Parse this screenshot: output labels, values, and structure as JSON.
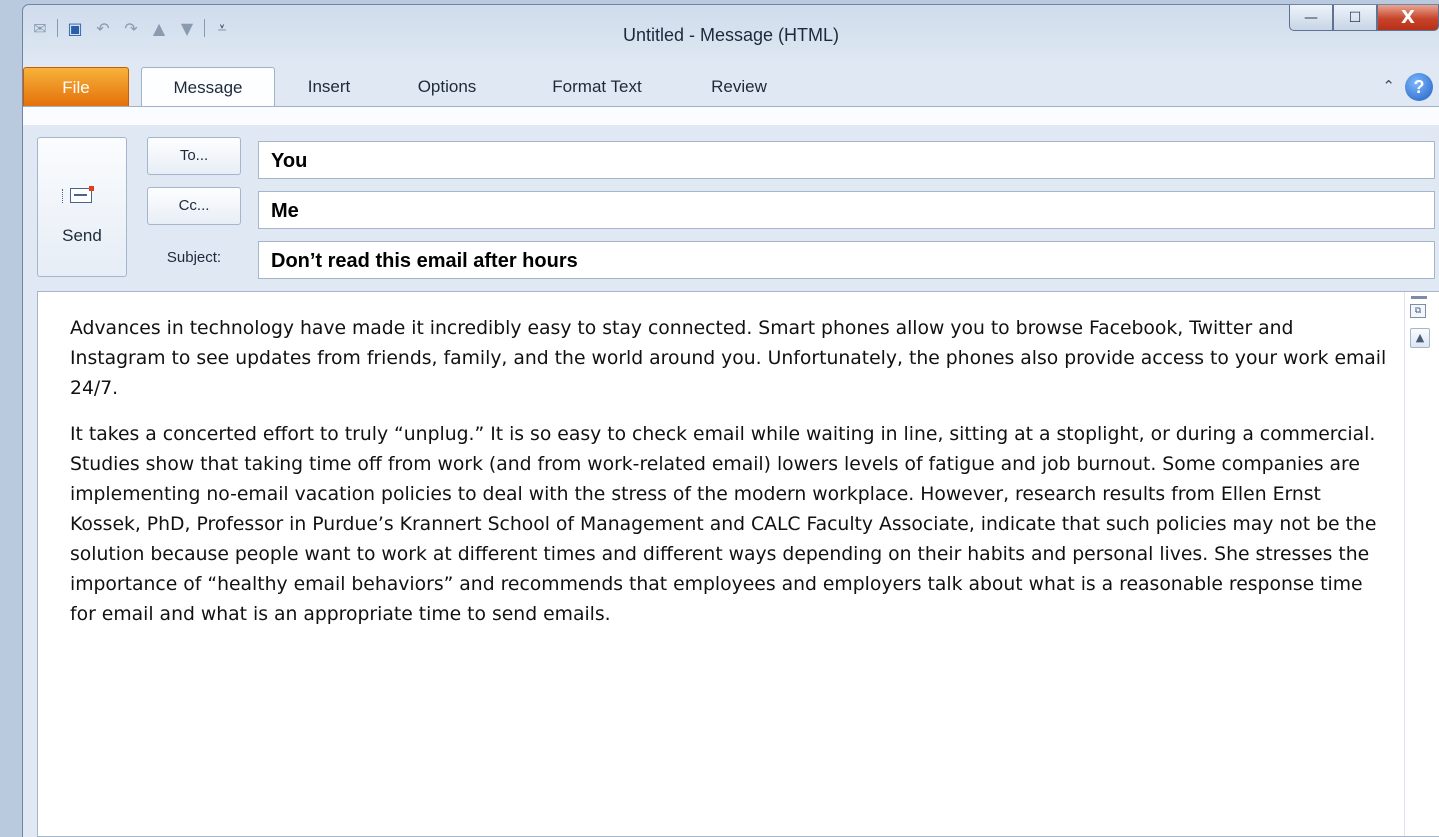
{
  "window": {
    "title": "Untitled - Message (HTML)",
    "controls": {
      "minimize": "—",
      "maximize": "☐",
      "close": "X"
    }
  },
  "quick_access": {
    "icons": [
      "mail-app-icon",
      "save-icon",
      "undo-icon",
      "redo-icon",
      "previous-item-icon",
      "next-item-icon",
      "customize-toolbar-icon"
    ]
  },
  "ribbon": {
    "tabs": [
      "File",
      "Message",
      "Insert",
      "Options",
      "Format Text",
      "Review"
    ],
    "active_tab": "Message",
    "help_label": "?"
  },
  "header": {
    "send_label": "Send",
    "to_button": "To...",
    "cc_button": "Cc...",
    "subject_label": "Subject:",
    "to_value": "You",
    "cc_value": "Me",
    "subject_value": "Don’t read this email after hours"
  },
  "body": {
    "paragraphs": [
      "Advances in technology have made it incredibly easy to stay connected.  Smart phones allow you to browse Facebook, Twitter and Instagram to see updates from friends, family, and the world around you.  Unfortunately, the phones also provide access to your work email 24/7.",
      "It takes a concerted effort to truly “unplug.”  It is so easy to check email while waiting in line, sitting at a stoplight, or during a commercial.  Studies show that taking time off from work (and from work-related email) lowers levels of fatigue and job burnout.  Some companies are implementing no-email vacation policies to deal with the stress of the modern workplace.  However, research results from Ellen Ernst Kossek, PhD, Professor in Purdue’s Krannert School of Management and CALC Faculty Associate, indicate that such policies may not be the solution because people want to work at different times and different ways depending on their habits and personal lives.  She stresses the importance of “healthy email behaviors” and recommends that employees and employers talk about what is a reasonable response time for email and what is an appropriate time to send emails."
    ]
  },
  "colors": {
    "file_tab": "#e46f09",
    "close_button": "#c7442b",
    "help_button": "#1e5fc2"
  }
}
